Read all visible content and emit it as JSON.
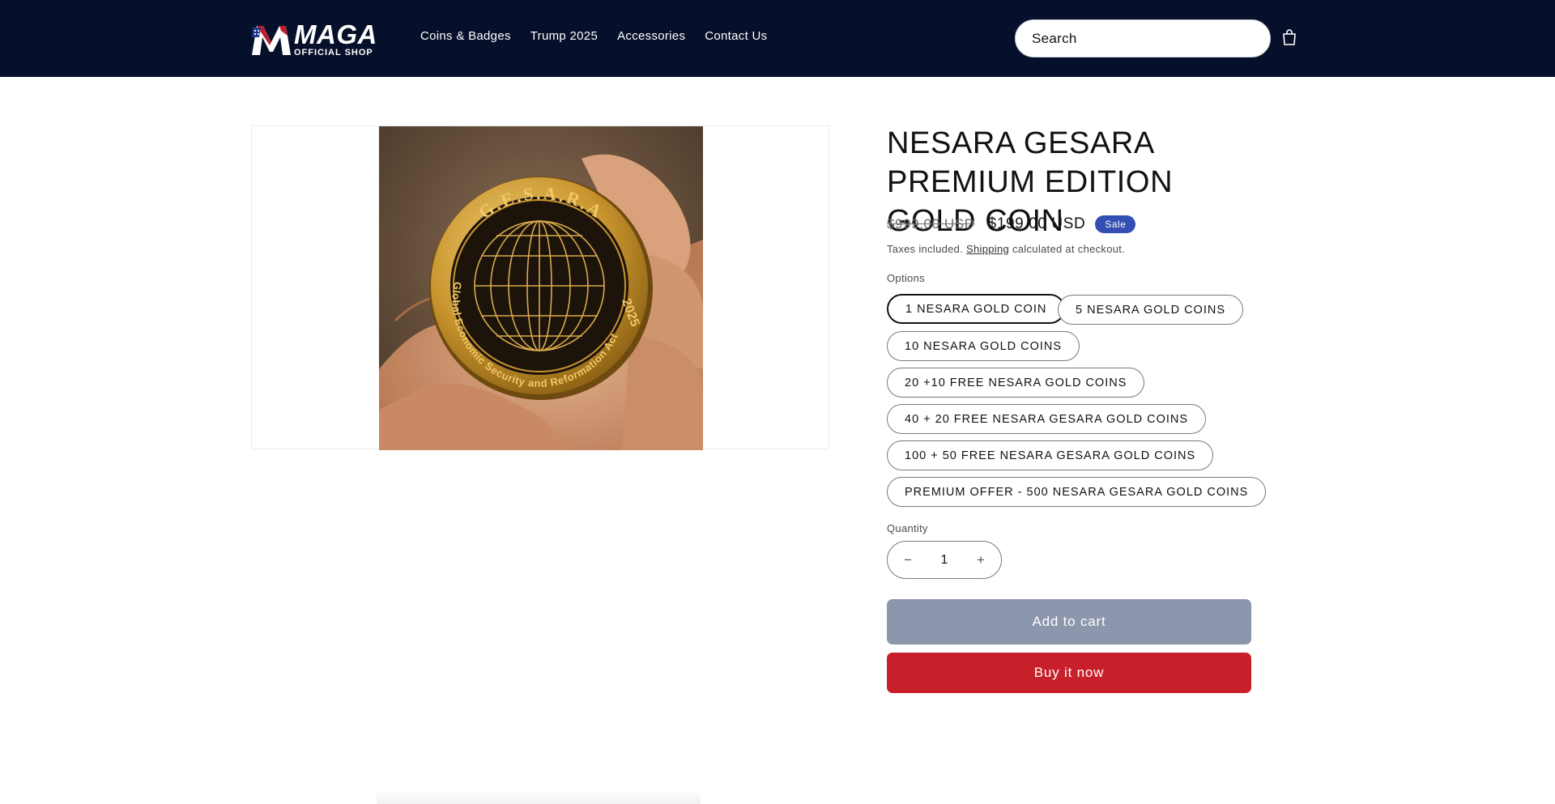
{
  "header": {
    "logo": {
      "text_main": "MAGA",
      "text_sub": "OFFICIAL SHOP"
    },
    "nav": [
      "Coins & Badges",
      "Trump 2025",
      "Accessories",
      "Contact Us"
    ],
    "search_placeholder": "Search",
    "cart_icon": "cart-icon"
  },
  "product": {
    "title": "NESARA GESARA PREMIUM EDITION GOLD COIN",
    "price_original": "$999.00 USD",
    "price_sale": "$199.00 USD",
    "badge": "Sale",
    "tax_prefix": "Taxes included.",
    "tax_link": "Shipping",
    "tax_suffix": "calculated at checkout.",
    "image_coin_text": {
      "top": "G.E.S.A.R.A",
      "year": "2025",
      "ring": "Global Economic Security and Reformation Act"
    }
  },
  "options": {
    "label": "Options",
    "items": [
      "1 NESARA GOLD COIN",
      "5 NESARA GOLD COINS",
      "10 NESARA GOLD COINS",
      "20 +10 FREE NESARA GOLD COINS",
      "40 + 20 FREE NESARA GESARA GOLD COINS",
      "100 + 50 FREE NESARA GESARA GOLD COINS",
      "PREMIUM OFFER - 500 NESARA GESARA GOLD COINS"
    ],
    "selected_index": 0
  },
  "quantity": {
    "label": "Quantity",
    "value": "1",
    "minus": "−",
    "plus": "+"
  },
  "buttons": {
    "add_to_cart": "Add to cart",
    "buy_now": "Buy it now"
  },
  "colors": {
    "header_bg": "#06102b",
    "sale_badge": "#334fb4",
    "buy_now": "#c8202a",
    "add_to_cart": "#8c97ad",
    "gold": "#d4a640"
  }
}
